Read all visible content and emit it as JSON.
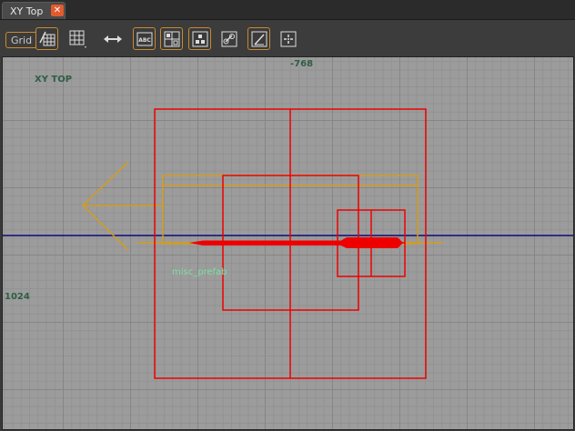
{
  "tab": {
    "title": "XY Top",
    "close_glyph": "✕"
  },
  "toolbar": {
    "grid_label": "Grid",
    "buttons": [
      {
        "icon": "grid-snap-icon"
      },
      {
        "icon": "grid-size-icon"
      },
      {
        "icon": "horizontal-arrows-icon"
      },
      {
        "icon": "text-abc-icon"
      },
      {
        "icon": "model-grid-icon"
      },
      {
        "icon": "texture-icon"
      },
      {
        "icon": "link-icon"
      },
      {
        "icon": "ruler-icon"
      },
      {
        "icon": "center-target-icon"
      }
    ]
  },
  "viewport": {
    "name_label": "XY TOP",
    "coord_top": "-768",
    "coord_left": "1024",
    "entity_label": "misc_prefab",
    "colors": {
      "background": "#9c9c9c",
      "selection": "#ff0000",
      "entity": "#d49c1c",
      "axis": "#0a0a7a",
      "entity_label": "#7ee0a0"
    }
  }
}
